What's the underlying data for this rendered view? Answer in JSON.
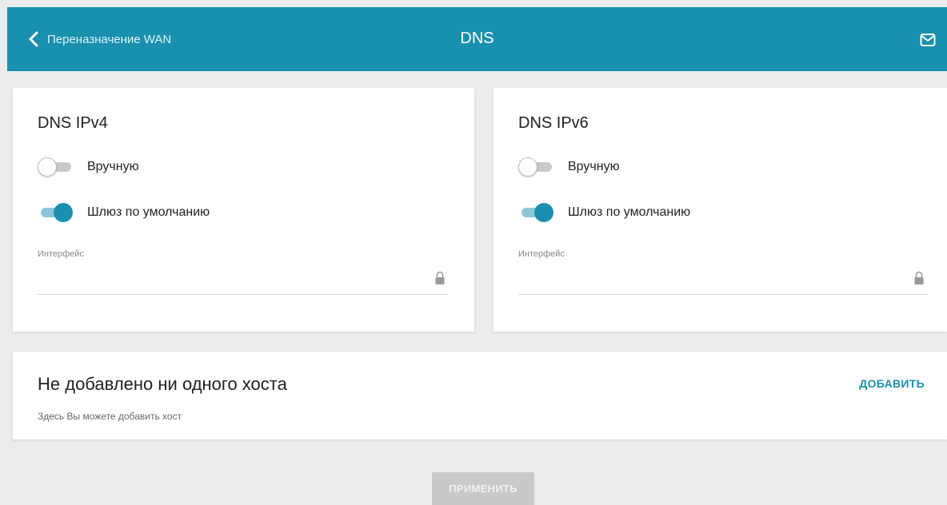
{
  "header": {
    "back_label": "Переназначение WAN",
    "title": "DNS",
    "accent_color": "#1890ae"
  },
  "ipv4": {
    "title": "DNS IPv4",
    "manual_label": "Вручную",
    "manual_on": false,
    "gateway_label": "Шлюз по умолчанию",
    "gateway_on": true,
    "interface_label": "Интерфейс",
    "interface_value": ""
  },
  "ipv6": {
    "title": "DNS IPv6",
    "manual_label": "Вручную",
    "manual_on": false,
    "gateway_label": "Шлюз по умолчанию",
    "gateway_on": true,
    "interface_label": "Интерфейс",
    "interface_value": ""
  },
  "hosts": {
    "title": "Не добавлено ни одного хоста",
    "subtitle": "Здесь Вы можете добавить хост",
    "add_label": "ДОБАВИТЬ"
  },
  "actions": {
    "apply_label": "ПРИМЕНИТЬ"
  },
  "icons": {
    "back": "chevron-left-icon",
    "mail": "mail-icon",
    "lock": "lock-icon"
  }
}
